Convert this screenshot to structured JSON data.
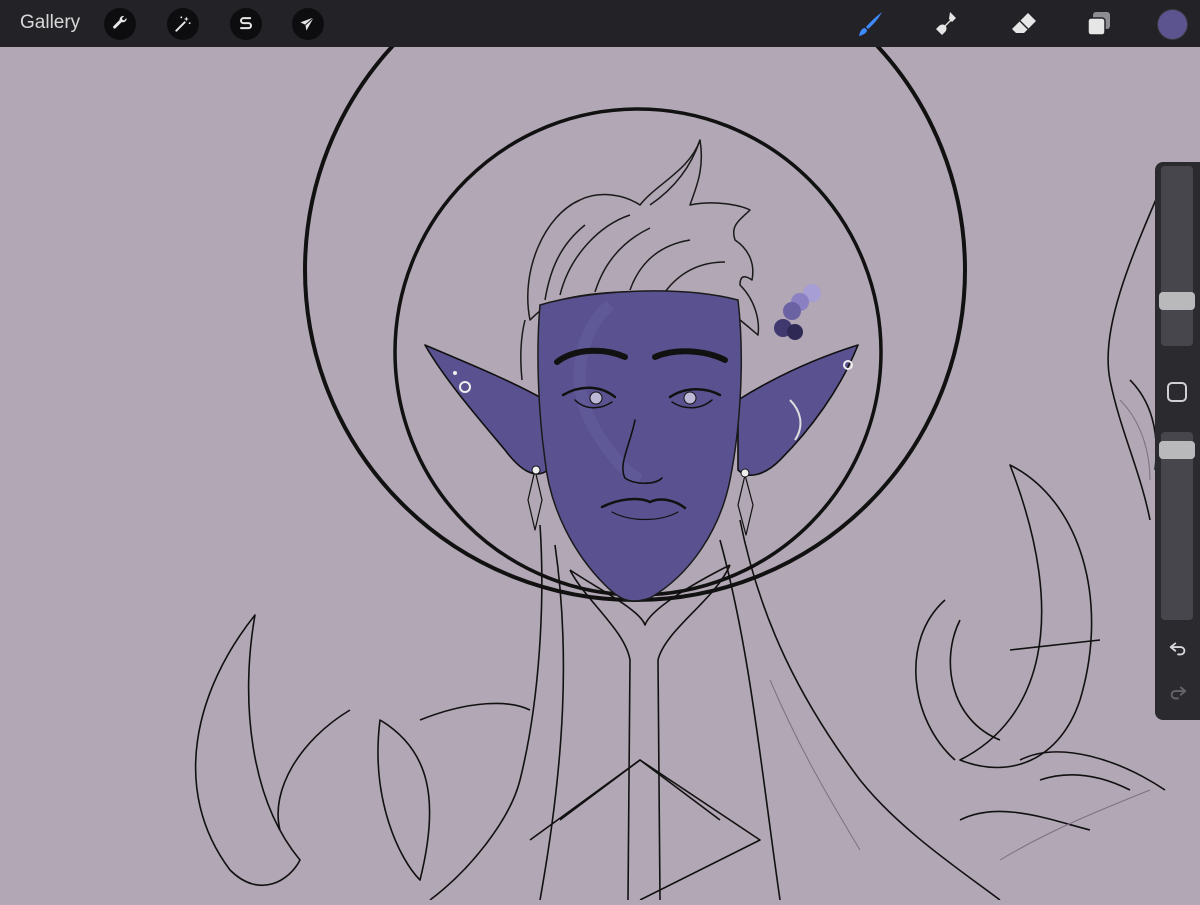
{
  "topbar": {
    "gallery_label": "Gallery",
    "left_tools": [
      {
        "name": "actions",
        "icon": "wrench-icon"
      },
      {
        "name": "adjustments",
        "icon": "magic-wand-icon"
      },
      {
        "name": "selection",
        "icon": "selection-s-icon"
      },
      {
        "name": "transform",
        "icon": "arrow-cursor-icon"
      }
    ],
    "right_tools": [
      {
        "name": "brush",
        "icon": "brush-icon",
        "active": true
      },
      {
        "name": "smudge",
        "icon": "smudge-icon",
        "active": false
      },
      {
        "name": "eraser",
        "icon": "eraser-icon",
        "active": false
      },
      {
        "name": "layers",
        "icon": "layers-icon",
        "active": false
      }
    ],
    "current_color": "#5c548f",
    "active_tool_color": "#3d8bff"
  },
  "sidebar": {
    "brush_size_level": 0.22,
    "opacity_level": 0.95,
    "controls": [
      "brush-size-slider",
      "modify-button",
      "opacity-slider",
      "undo-button",
      "redo-button"
    ]
  },
  "canvas": {
    "background_color": "#b2a7b5",
    "skin_color": "#5a5290",
    "line_color": "#111111",
    "palette_dots": [
      "#a79ed6",
      "#8a80c2",
      "#6a62a3",
      "#3f3970",
      "#2e2a55"
    ]
  }
}
